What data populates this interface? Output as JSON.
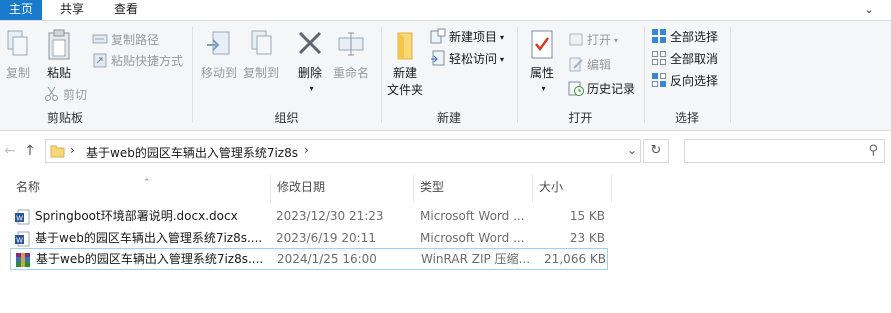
{
  "tabs": [
    "主页",
    "共享",
    "查看"
  ],
  "ribbon": {
    "clipboard": {
      "title": "剪贴板",
      "copy": "复制",
      "paste": "粘贴",
      "copy_path": "复制路径",
      "paste_shortcut": "粘贴快捷方式",
      "cut": "剪切"
    },
    "organize": {
      "title": "组织",
      "move_to": "移动到",
      "copy_to": "复制到",
      "delete": "删除",
      "rename": "重命名"
    },
    "new": {
      "title": "新建",
      "new_folder": "新建\n文件夹",
      "new_folder_line1": "新建",
      "new_folder_line2": "文件夹",
      "new_item": "新建项目",
      "easy_access": "轻松访问"
    },
    "open": {
      "title": "打开",
      "properties": "属性",
      "open": "打开",
      "edit": "编辑",
      "history": "历史记录"
    },
    "select": {
      "title": "选择",
      "select_all": "全部选择",
      "select_none": "全部取消",
      "invert": "反向选择"
    }
  },
  "address": {
    "path": "基于web的园区车辆出入管理系统7iz8s"
  },
  "search": {
    "placeholder": ""
  },
  "columns": {
    "name": "名称",
    "date": "修改日期",
    "type": "类型",
    "size": "大小"
  },
  "files": [
    {
      "name": "Springboot环境部署说明.docx.docx",
      "date": "2023/12/30 21:23",
      "type": "Microsoft Word ...",
      "size": "15 KB",
      "icon": "word-doc-icon"
    },
    {
      "name": "基于web的园区车辆出入管理系统7iz8s....",
      "date": "2023/6/19 20:11",
      "type": "Microsoft Word ...",
      "size": "23 KB",
      "icon": "word-doc-icon"
    },
    {
      "name": "基于web的园区车辆出入管理系统7iz8s....",
      "date": "2024/1/25 16:00",
      "type": "WinRAR ZIP 压缩...",
      "size": "21,066 KB",
      "icon": "winrar-archive-icon"
    }
  ],
  "colors": {
    "accent": "#1979ca",
    "selection_border": "#99d1ff",
    "folder": "#f8d775"
  }
}
